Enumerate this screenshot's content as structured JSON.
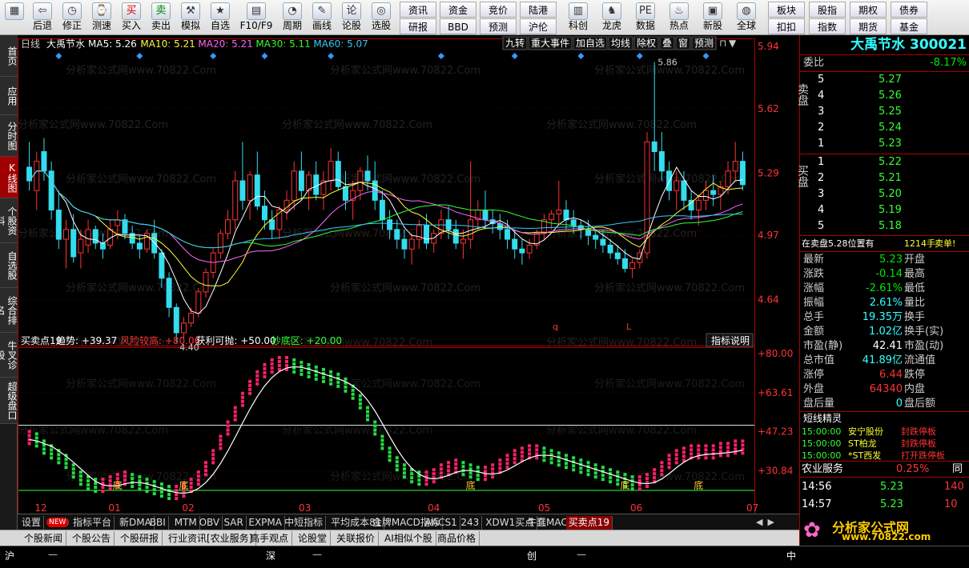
{
  "toolbar": {
    "items": [
      {
        "label": "",
        "icon": "windows-icon"
      },
      {
        "label": "后退",
        "icon": "back-arrow-icon"
      },
      {
        "label": "修正",
        "icon": "clock-icon"
      },
      {
        "label": "测速",
        "icon": "speed-icon"
      },
      {
        "label": "买入",
        "icon": "buy-icon",
        "iconText": "买"
      },
      {
        "label": "卖出",
        "icon": "sell-icon",
        "iconText": "卖"
      },
      {
        "label": "模拟",
        "icon": "hammer-icon"
      },
      {
        "label": "自选",
        "icon": "star-icon"
      },
      {
        "label": "F10/F9",
        "icon": "f10-icon"
      },
      {
        "label": "周期",
        "icon": "period-icon"
      },
      {
        "label": "画线",
        "icon": "pencil-icon"
      },
      {
        "label": "论股",
        "icon": "discuss-icon",
        "iconText": "论"
      },
      {
        "label": "选股",
        "icon": "select-stock-icon"
      }
    ],
    "grid": [
      [
        "资讯",
        "资金",
        "竞价",
        "陆港"
      ],
      [
        "研报",
        "BBD",
        "预测",
        "沪伦"
      ]
    ],
    "items2": [
      {
        "label": "科创",
        "icon": "chart-icon"
      },
      {
        "label": "龙虎",
        "icon": "dragon-icon"
      },
      {
        "label": "数据",
        "icon": "pe-icon",
        "iconText": "PE"
      },
      {
        "label": "热点",
        "icon": "hot-icon",
        "iconText": "HOT"
      },
      {
        "label": "新股",
        "icon": "new-stock-icon"
      },
      {
        "label": "全球",
        "icon": "globe-icon"
      }
    ],
    "grid2": [
      [
        "板块",
        "股指",
        "期权",
        "债券"
      ],
      [
        "扣扣",
        "指数",
        "期货",
        "基金"
      ]
    ]
  },
  "leftnav": [
    {
      "label": "首页"
    },
    {
      "label": "应用"
    },
    {
      "label": "分时图"
    },
    {
      "label": "K线图",
      "active": true
    },
    {
      "label": "个股资料"
    },
    {
      "label": "自选股"
    },
    {
      "label": "综合排名"
    },
    {
      "label": "牛叉诊股"
    },
    {
      "label": "超级盘口"
    }
  ],
  "chart": {
    "header": {
      "period": "日线",
      "name": "大禹节水",
      "ma5": "MA5: 5.26",
      "ma10": "MA10: 5.21",
      "ma20": "MA20: 5.21",
      "ma30": "MA30: 5.11",
      "ma60": "MA60: 5.07"
    },
    "buttons": [
      "九转",
      "重大事件",
      "加自选",
      "均线",
      "除权",
      "叠",
      "窗",
      "预测"
    ],
    "price_axis": [
      "5.94",
      "5.62",
      "5.29",
      "4.97",
      "4.64"
    ],
    "high_label": "5.86",
    "low_label": "4.40",
    "marks": [
      "q",
      "L"
    ],
    "watermark": "分析家公式网www.70822.Com",
    "indicator": {
      "name": "买卖点19",
      "trend": "趋势: +39.37",
      "risk": "风险较高: +80.00",
      "profit": "获利可抛: +50.00",
      "bottom": "抄底区: +20.00",
      "explain_btn": "指标说明",
      "axis": [
        "+80.00",
        "+63.61",
        "+47.23",
        "+30.84"
      ],
      "bottom_label": "底"
    },
    "months": [
      "12",
      "01",
      "02",
      "03",
      "04",
      "05",
      "06",
      "07"
    ]
  },
  "chart_data": {
    "type": "candlestick",
    "title": "大禹节水",
    "ohlc": [
      [
        5.32,
        5.45,
        5.2,
        5.25
      ],
      [
        5.2,
        5.4,
        5.1,
        5.35
      ],
      [
        5.4,
        5.47,
        5.25,
        5.3
      ],
      [
        5.3,
        5.35,
        5.05,
        5.1
      ],
      [
        5.1,
        5.2,
        4.9,
        4.95
      ],
      [
        4.95,
        5.05,
        4.8,
        5.0
      ],
      [
        5.0,
        5.08,
        4.83,
        4.86
      ],
      [
        4.88,
        5.0,
        4.8,
        4.95
      ],
      [
        4.92,
        5.05,
        4.88,
        5.0
      ],
      [
        5.0,
        5.02,
        4.9,
        4.93
      ],
      [
        4.93,
        4.98,
        4.85,
        4.9
      ],
      [
        4.92,
        5.05,
        4.9,
        5.0
      ],
      [
        5.02,
        5.1,
        4.95,
        5.05
      ],
      [
        5.05,
        5.08,
        4.95,
        4.98
      ],
      [
        4.98,
        5.02,
        4.9,
        4.93
      ],
      [
        4.93,
        4.97,
        4.85,
        4.9
      ],
      [
        4.9,
        5.0,
        4.88,
        4.98
      ],
      [
        4.98,
        5.05,
        4.85,
        4.88
      ],
      [
        4.88,
        4.9,
        4.7,
        4.75
      ],
      [
        4.75,
        4.78,
        4.55,
        4.6
      ],
      [
        4.6,
        4.62,
        4.42,
        4.47
      ],
      [
        4.47,
        4.55,
        4.44,
        4.52
      ],
      [
        4.52,
        4.6,
        4.5,
        4.57
      ],
      [
        4.57,
        4.7,
        4.55,
        4.68
      ],
      [
        4.68,
        4.8,
        4.65,
        4.78
      ],
      [
        4.78,
        4.9,
        4.75,
        4.88
      ],
      [
        4.88,
        5.0,
        4.85,
        4.98
      ],
      [
        4.98,
        5.1,
        4.95,
        5.05
      ],
      [
        5.05,
        5.3,
        5.0,
        5.25
      ],
      [
        5.25,
        5.45,
        5.1,
        5.15
      ],
      [
        5.15,
        5.3,
        5.05,
        5.28
      ],
      [
        5.28,
        5.4,
        5.1,
        5.12
      ],
      [
        5.12,
        5.2,
        5.0,
        5.05
      ],
      [
        5.05,
        5.1,
        4.95,
        5.0
      ],
      [
        5.0,
        5.12,
        4.95,
        5.1
      ],
      [
        5.1,
        5.2,
        5.05,
        5.15
      ],
      [
        5.15,
        5.35,
        5.1,
        5.3
      ],
      [
        5.3,
        5.4,
        5.15,
        5.2
      ],
      [
        5.2,
        5.3,
        5.1,
        5.28
      ],
      [
        5.28,
        5.35,
        5.15,
        5.18
      ],
      [
        5.18,
        5.3,
        5.1,
        5.25
      ],
      [
        5.25,
        5.42,
        5.2,
        5.35
      ],
      [
        5.35,
        5.4,
        5.2,
        5.22
      ],
      [
        5.22,
        5.3,
        5.1,
        5.15
      ],
      [
        5.15,
        5.25,
        5.05,
        5.2
      ],
      [
        5.2,
        5.32,
        5.15,
        5.3
      ],
      [
        5.3,
        5.38,
        5.2,
        5.25
      ],
      [
        5.25,
        5.35,
        5.1,
        5.15
      ],
      [
        5.15,
        5.2,
        5.0,
        5.05
      ],
      [
        5.05,
        5.1,
        4.95,
        5.0
      ],
      [
        5.0,
        5.05,
        4.9,
        4.95
      ],
      [
        4.95,
        5.0,
        4.85,
        4.9
      ],
      [
        4.9,
        4.98,
        4.82,
        4.95
      ],
      [
        4.95,
        5.05,
        4.9,
        5.02
      ],
      [
        5.02,
        5.08,
        4.9,
        4.93
      ],
      [
        4.93,
        5.0,
        4.88,
        4.98
      ],
      [
        4.98,
        5.1,
        4.95,
        5.05
      ],
      [
        5.05,
        5.12,
        4.95,
        5.0
      ],
      [
        5.0,
        5.05,
        4.9,
        4.93
      ],
      [
        4.93,
        5.0,
        4.85,
        4.95
      ],
      [
        4.95,
        5.35,
        4.9,
        5.05
      ],
      [
        5.05,
        5.15,
        5.0,
        5.1
      ],
      [
        5.1,
        5.2,
        5.0,
        5.05
      ],
      [
        5.05,
        5.1,
        4.98,
        5.03
      ],
      [
        5.03,
        5.08,
        4.95,
        5.0
      ],
      [
        5.0,
        5.05,
        4.9,
        4.95
      ],
      [
        4.95,
        5.0,
        4.85,
        4.9
      ],
      [
        4.9,
        4.95,
        4.82,
        4.88
      ],
      [
        4.88,
        4.95,
        4.85,
        4.92
      ],
      [
        4.92,
        5.0,
        4.9,
        4.98
      ],
      [
        4.98,
        5.08,
        4.95,
        5.05
      ],
      [
        5.05,
        5.1,
        5.0,
        5.08
      ],
      [
        5.08,
        5.25,
        5.02,
        5.1
      ],
      [
        5.1,
        5.15,
        5.0,
        5.05
      ],
      [
        5.05,
        5.1,
        4.98,
        5.02
      ],
      [
        5.02,
        5.05,
        4.95,
        5.0
      ],
      [
        5.0,
        5.05,
        4.92,
        4.97
      ],
      [
        4.97,
        5.0,
        4.9,
        4.95
      ],
      [
        4.95,
        5.0,
        4.88,
        4.92
      ],
      [
        4.92,
        4.95,
        4.85,
        4.88
      ],
      [
        4.88,
        4.92,
        4.82,
        4.85
      ],
      [
        4.85,
        4.9,
        4.78,
        4.8
      ],
      [
        4.8,
        4.85,
        4.75,
        4.83
      ],
      [
        4.83,
        4.9,
        4.8,
        4.88
      ],
      [
        4.88,
        5.5,
        4.85,
        5.45
      ],
      [
        5.45,
        5.86,
        5.3,
        5.4
      ],
      [
        5.4,
        5.5,
        5.25,
        5.3
      ],
      [
        5.3,
        5.35,
        5.15,
        5.2
      ],
      [
        5.2,
        5.3,
        5.1,
        5.25
      ],
      [
        5.25,
        5.3,
        5.1,
        5.15
      ],
      [
        5.15,
        5.2,
        5.05,
        5.1
      ],
      [
        5.1,
        5.18,
        5.02,
        5.15
      ],
      [
        5.15,
        5.25,
        5.1,
        5.2
      ],
      [
        5.2,
        5.28,
        5.12,
        5.18
      ],
      [
        5.18,
        5.25,
        5.1,
        5.22
      ],
      [
        5.22,
        5.35,
        5.18,
        5.3
      ],
      [
        5.3,
        5.45,
        5.25,
        5.35
      ],
      [
        5.35,
        5.4,
        5.2,
        5.23
      ]
    ],
    "ylim": [
      4.4,
      5.94
    ],
    "indicator_values": [
      48,
      47,
      44,
      42,
      40,
      38,
      34,
      31,
      29,
      28,
      28,
      29,
      30,
      31,
      30,
      29,
      28,
      27,
      26,
      25,
      25,
      26,
      28,
      31,
      35,
      40,
      46,
      52,
      58,
      64,
      69,
      73,
      76,
      78,
      79,
      79,
      78,
      77,
      76,
      75,
      74,
      73,
      72,
      70,
      67,
      63,
      58,
      52,
      46,
      41,
      37,
      34,
      32,
      31,
      31,
      32,
      34,
      35,
      36,
      35,
      34,
      33,
      33,
      34,
      36,
      38,
      40,
      41,
      42,
      42,
      41,
      40,
      39,
      38,
      37,
      36,
      35,
      34,
      33,
      32,
      31,
      30,
      29,
      29,
      30,
      32,
      35,
      38,
      40,
      41,
      42,
      42,
      42,
      42,
      43,
      43,
      44,
      44
    ],
    "indicator_ylim": [
      20,
      82
    ]
  },
  "quote": {
    "title": "大禹节水 300021",
    "weibi_label": "委比",
    "weibi_value": "-8.17%",
    "sell_label": "卖盘",
    "sell": [
      {
        "lvl": "5",
        "price": "5.27"
      },
      {
        "lvl": "4",
        "price": "5.26"
      },
      {
        "lvl": "3",
        "price": "5.25"
      },
      {
        "lvl": "2",
        "price": "5.24"
      },
      {
        "lvl": "1",
        "price": "5.23"
      }
    ],
    "buy_label": "买盘",
    "buy": [
      {
        "lvl": "1",
        "price": "5.22"
      },
      {
        "lvl": "2",
        "price": "5.21"
      },
      {
        "lvl": "3",
        "price": "5.20"
      },
      {
        "lvl": "4",
        "price": "5.19"
      },
      {
        "lvl": "5",
        "price": "5.18"
      }
    ],
    "order_note": "在卖盘5.28位置有",
    "order_qty": "1214手",
    "order_type": "卖单!",
    "stats": [
      {
        "l": "最新",
        "v": "5.23",
        "c": "grn",
        "l2": "开盘"
      },
      {
        "l": "涨跌",
        "v": "-0.14",
        "c": "grn",
        "l2": "最高"
      },
      {
        "l": "涨幅",
        "v": "-2.61%",
        "c": "grn",
        "l2": "最低"
      },
      {
        "l": "振幅",
        "v": "2.61%",
        "c": "cyan",
        "l2": "量比"
      },
      {
        "l": "总手",
        "v": "19.35万",
        "c": "cyan",
        "l2": "换手"
      },
      {
        "l": "金额",
        "v": "1.02亿",
        "c": "cyan",
        "l2": "换手(实)"
      },
      {
        "l": "市盈(静)",
        "v": "42.41",
        "c": "wht",
        "l2": "市盈(动)"
      },
      {
        "l": "总市值",
        "v": "41.89亿",
        "c": "cyan",
        "l2": "流通值"
      },
      {
        "l": "涨停",
        "v": "6.44",
        "c": "red",
        "l2": "跌停"
      },
      {
        "l": "外盘",
        "v": "64340",
        "c": "red",
        "l2": "内盘"
      },
      {
        "l": "盘后量",
        "v": "0",
        "c": "cyan",
        "l2": "盘后额"
      }
    ],
    "spirit_title": "短线精灵",
    "spirit": [
      {
        "t": "15:00:00",
        "n": "安宁股份",
        "e": "封跌停板"
      },
      {
        "t": "15:00:00",
        "n": "ST柏龙",
        "e": "封跌停板"
      },
      {
        "t": "15:00:00",
        "n": "*ST西发",
        "e": "打开跌停板"
      }
    ],
    "sector_name": "农业服务",
    "sector_pct": "0.25%",
    "sector_extra": "同",
    "ticks": [
      {
        "t": "14:56",
        "p": "5.23",
        "v": "140"
      },
      {
        "t": "14:57",
        "p": "5.23",
        "v": "10"
      }
    ],
    "logo_text": "分析家公式网",
    "logo_url": "www.70822.com"
  },
  "tabs1": [
    "设置",
    "NEW",
    "指标平台",
    "新DMA",
    "BBI",
    "MTM",
    "OBV",
    "SAR",
    "EXPMA",
    "中短指标",
    "平均成本81",
    "金牌MACD指标",
    "AACS1",
    "243",
    "XDW1买点",
    "牛蠢MACD",
    "买卖点19"
  ],
  "tabs2": [
    "个股新闻",
    "个股公告",
    "个股研报",
    "行业资讯[农业服务]",
    "高手观点",
    "论股堂",
    "关联报价",
    "AI相似个股",
    "商品价格"
  ],
  "status": {
    "sh": "沪",
    "sh_v": "—",
    "sz": "深",
    "sz_v": "—",
    "cy": "创",
    "cy_v": "—",
    "zh": "中"
  }
}
